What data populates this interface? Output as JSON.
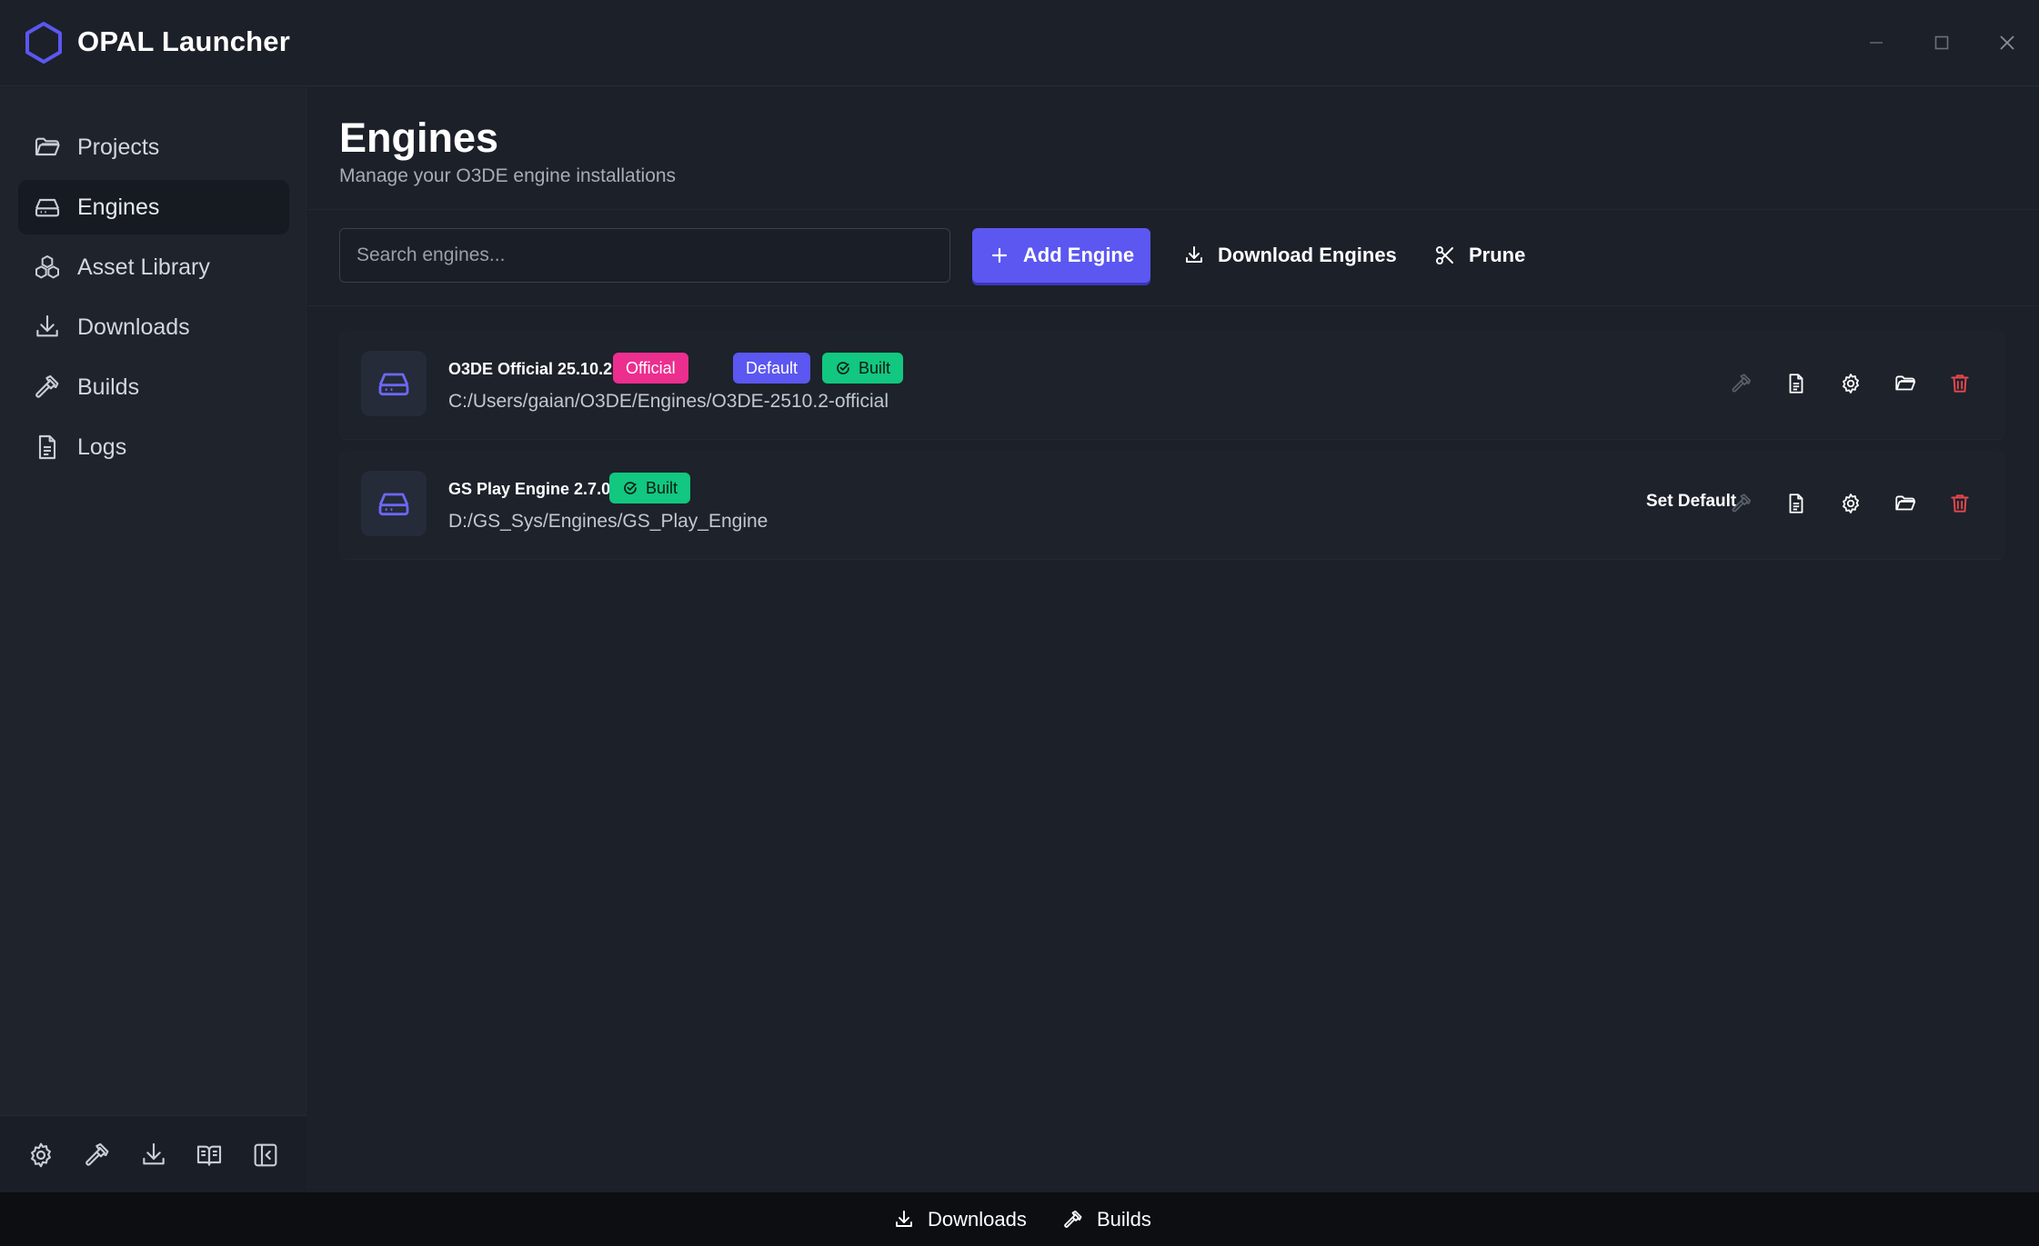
{
  "app": {
    "title": "OPAL Launcher"
  },
  "sidebar": {
    "items": [
      {
        "label": "Projects",
        "icon": "folder-icon"
      },
      {
        "label": "Engines",
        "icon": "drive-icon",
        "active": true
      },
      {
        "label": "Asset Library",
        "icon": "boxes-icon"
      },
      {
        "label": "Downloads",
        "icon": "download-icon"
      },
      {
        "label": "Builds",
        "icon": "hammer-icon"
      },
      {
        "label": "Logs",
        "icon": "document-icon"
      }
    ],
    "bottom_icons": [
      "gear-icon",
      "hammer-icon",
      "download-icon",
      "book-icon",
      "collapse-sidebar-icon"
    ]
  },
  "page": {
    "title": "Engines",
    "subtitle": "Manage your O3DE engine installations"
  },
  "toolbar": {
    "search_placeholder": "Search engines...",
    "add_label": "Add Engine",
    "download_label": "Download Engines",
    "prune_label": "Prune"
  },
  "engines": [
    {
      "name": "O3DE Official 25.10.2",
      "path": "C:/Users/gaian/O3DE/Engines/O3DE-2510.2-official",
      "badges": {
        "official": "Official",
        "default": "Default",
        "built": "Built"
      }
    },
    {
      "name": "GS Play Engine 2.7.0",
      "path": "D:/GS_Sys/Engines/GS_Play_Engine",
      "badges": {
        "built": "Built"
      },
      "set_default_label": "Set Default"
    }
  ],
  "statusbar": {
    "downloads_label": "Downloads",
    "builds_label": "Builds"
  },
  "colors": {
    "accent": "#5b57f0",
    "official": "#ec2e8f",
    "built": "#12c77f",
    "danger": "#e5484d"
  }
}
